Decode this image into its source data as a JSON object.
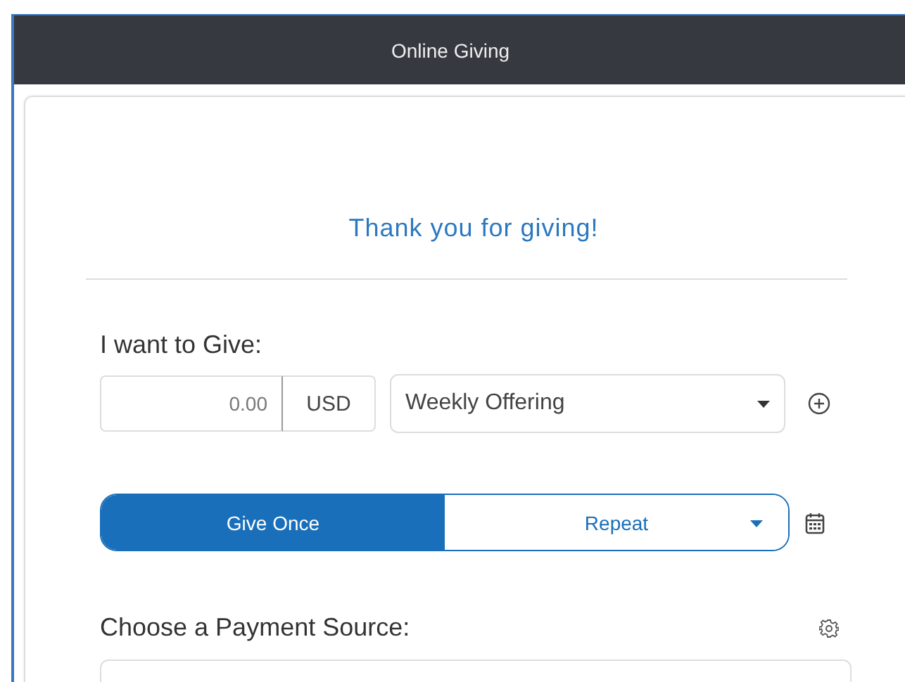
{
  "header": {
    "title": "Online Giving"
  },
  "thank_you": "Thank you for giving!",
  "give_label": "I want to Give:",
  "amount": {
    "placeholder": "0.00",
    "currency": "USD"
  },
  "fund": {
    "value": "Weekly Offering"
  },
  "frequency": [
    {
      "label": "Give Once",
      "selected": true,
      "kind": "plain"
    },
    {
      "label": "Repeat",
      "selected": false,
      "kind": "dropdown"
    }
  ],
  "payment_label": "Choose a Payment Source:"
}
